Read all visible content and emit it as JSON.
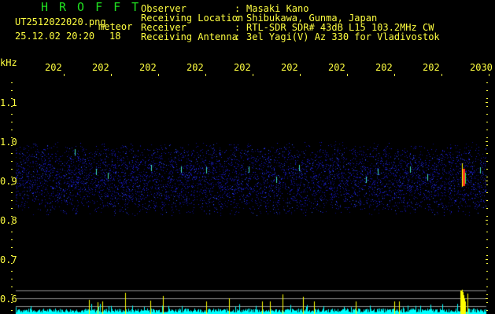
{
  "header": {
    "app_name": "HROFFT",
    "filename": "UT2512022020.png",
    "mode": "meteor",
    "datetime": "25.12.02 20:20",
    "value": "18",
    "info": [
      {
        "label": "Observer",
        "value": "Masaki Kano"
      },
      {
        "label": "Receiving Location",
        "value": "Shibukawa, Gunma, Japan"
      },
      {
        "label": "Receiver",
        "value": "RTL-SDR SDR# 43dB L15 103.2MHz CW"
      },
      {
        "label": "Receiving Antenna",
        "value": "3el Yagi(V) Az 330 for Vladivostok"
      }
    ]
  },
  "axis": {
    "y_unit": "kHz",
    "y_ticks": [
      "1.1",
      "1.0",
      "0.9",
      "0.8",
      "0.7",
      "0.6"
    ],
    "x_ticks": [
      "2021",
      "2022",
      "2023",
      "2024",
      "2025",
      "2026",
      "2027",
      "2028",
      "2029",
      "2030"
    ]
  },
  "colors": {
    "text": "#ffff40",
    "logo": "#20e020",
    "noise": "#1010c0",
    "spectrum": "#00ffff",
    "peak": "#ffff00"
  }
}
